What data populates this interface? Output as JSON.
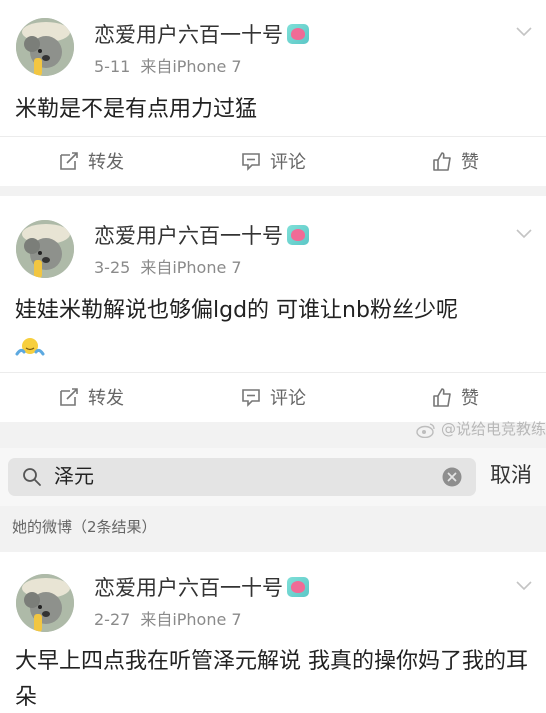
{
  "posts": [
    {
      "username": "恋爱用户六百一十号",
      "date": "5-11",
      "source": "来自iPhone 7",
      "text": "米勒是不是有点用力过猛",
      "actions": {
        "repost": "转发",
        "comment": "评论",
        "like": "赞"
      }
    },
    {
      "username": "恋爱用户六百一十号",
      "date": "3-25",
      "source": "来自iPhone 7",
      "text": "娃娃米勒解说也够偏lgd的 可谁让nb粉丝少呢",
      "actions": {
        "repost": "转发",
        "comment": "评论",
        "like": "赞"
      }
    },
    {
      "username": "恋爱用户六百一十号",
      "date": "2-27",
      "source": "来自iPhone 7",
      "text": "大早上四点我在听管泽元解说 我真的操你妈了我的耳朵"
    }
  ],
  "watermark": "@说给电竞教练",
  "search": {
    "query": "泽元",
    "cancel_label": "取消"
  },
  "section_label": "她的微博（2条结果）",
  "colors": {
    "badge_heart": "#f06b96",
    "badge_bg": "#6fd6d0",
    "meta_text": "#8a8a8a",
    "separator": "#f2f2f2"
  },
  "icons": [
    "chevron-down-icon",
    "repost-icon",
    "comment-icon",
    "like-icon",
    "search-icon",
    "clear-icon",
    "weibo-logo-icon",
    "shrug-emoji-icon"
  ]
}
